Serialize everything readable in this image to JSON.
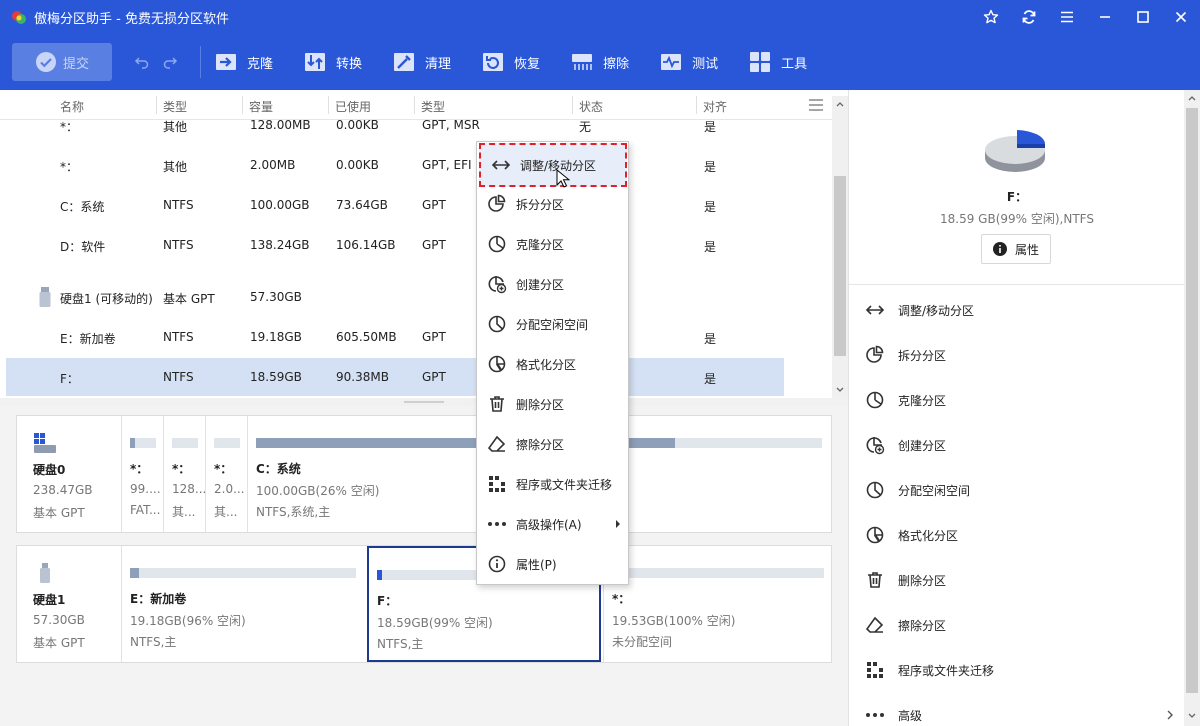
{
  "app": {
    "title": "傲梅分区助手 - 免费无损分区软件"
  },
  "toolbar": {
    "submit": "提交",
    "items": [
      "克隆",
      "转换",
      "清理",
      "恢复",
      "擦除",
      "测试",
      "工具"
    ]
  },
  "table": {
    "headers": [
      "名称",
      "类型",
      "容量",
      "已使用",
      "类型",
      "状态",
      "对齐"
    ],
    "rows": [
      [
        "*：",
        "其他",
        "128.00MB",
        "0.00KB",
        "GPT, MSR",
        "无",
        "是"
      ],
      [
        "*：",
        "其他",
        "2.00MB",
        "0.00KB",
        "GPT, EFI",
        "",
        "是"
      ],
      [
        "C：系统",
        "NTFS",
        "100.00GB",
        "73.64GB",
        "GPT",
        "",
        "是"
      ],
      [
        "D：软件",
        "NTFS",
        "138.24GB",
        "106.14GB",
        "GPT",
        "",
        "是"
      ],
      [
        "硬盘1 (可移动的)",
        "基本 GPT",
        "57.30GB",
        "",
        "",
        "",
        ""
      ],
      [
        "E：新加卷",
        "NTFS",
        "19.18GB",
        "605.50MB",
        "GPT",
        "",
        "是"
      ],
      [
        "F：",
        "NTFS",
        "18.59GB",
        "90.38MB",
        "GPT",
        "",
        "是"
      ]
    ]
  },
  "disks": [
    {
      "name": "硬盘0",
      "size": "238.47GB",
      "type": "基本 GPT",
      "partitions": [
        {
          "name": "*：",
          "stat": "99....",
          "fs": "FAT...",
          "used": 0.2
        },
        {
          "name": "*：",
          "stat": "128...",
          "fs": "其...",
          "used": 0
        },
        {
          "name": "*：",
          "stat": "2.0...",
          "fs": "其...",
          "used": 0
        },
        {
          "name": "C：系统",
          "stat": "100.00GB(26% 空闲)",
          "fs": "NTFS,系统,主",
          "used": 0.74
        }
      ]
    },
    {
      "name": "硬盘1",
      "size": "57.30GB",
      "type": "基本 GPT",
      "partitions": [
        {
          "name": "E：新加卷",
          "stat": "19.18GB(96% 空闲)",
          "fs": "NTFS,主",
          "used": 0.04
        },
        {
          "name": "F：",
          "stat": "18.59GB(99% 空闲)",
          "fs": "NTFS,主",
          "used": 0.01
        },
        {
          "name": "*：",
          "stat": "19.53GB(100% 空闲)",
          "fs": "未分配空间",
          "used": 0
        }
      ]
    }
  ],
  "details": {
    "name": "F：",
    "info": "18.59 GB(99% 空闲),NTFS",
    "properties": "属性",
    "ops": [
      "调整/移动分区",
      "拆分分区",
      "克隆分区",
      "创建分区",
      "分配空闲空间",
      "格式化分区",
      "删除分区",
      "擦除分区",
      "程序或文件夹迁移",
      "高级"
    ]
  },
  "context_menu": {
    "items": [
      "调整/移动分区",
      "拆分分区",
      "克隆分区",
      "创建分区",
      "分配空闲空间",
      "格式化分区",
      "删除分区",
      "擦除分区",
      "程序或文件夹迁移",
      "高级操作(A)",
      "属性(P)"
    ]
  },
  "colors": {
    "brand": "#2a57d8",
    "selected_row": "#d4e1f4",
    "highlight_border": "#e0202a"
  }
}
